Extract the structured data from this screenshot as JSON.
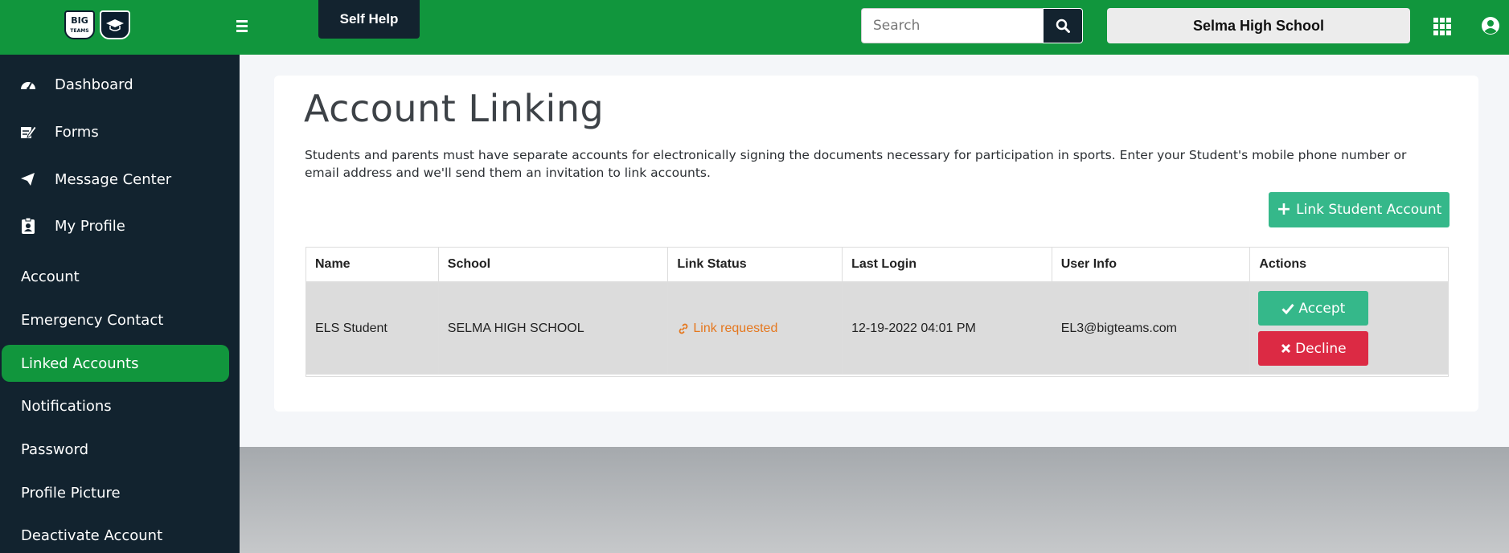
{
  "header": {
    "logo_text_1": "BIG",
    "logo_text_2": "TEAMS",
    "self_help_label": "Self Help",
    "search_placeholder": "Search",
    "school_name": "Selma High School"
  },
  "sidebar": {
    "main_items": [
      {
        "label": "Dashboard",
        "icon": "gauge-icon"
      },
      {
        "label": "Forms",
        "icon": "form-edit-icon"
      },
      {
        "label": "Message Center",
        "icon": "paper-plane-icon"
      },
      {
        "label": "My Profile",
        "icon": "id-badge-icon"
      }
    ],
    "sub_items": [
      {
        "label": "Account"
      },
      {
        "label": "Emergency Contact"
      },
      {
        "label": "Linked Accounts",
        "active": true
      },
      {
        "label": "Notifications"
      },
      {
        "label": "Password"
      },
      {
        "label": "Profile Picture"
      },
      {
        "label": "Deactivate Account"
      }
    ]
  },
  "main": {
    "title": "Account Linking",
    "description": "Students and parents must have separate accounts for electronically signing the documents necessary for participation in sports. Enter your Student's mobile phone number or email address and we'll send them an invitation to link accounts.",
    "link_button_label": "Link Student Account",
    "table": {
      "headers": [
        "Name",
        "School",
        "Link Status",
        "Last Login",
        "User Info",
        "Actions"
      ],
      "rows": [
        {
          "name": "ELS Student",
          "school": "SELMA HIGH SCHOOL",
          "status": "Link requested",
          "last_login": "12-19-2022 04:01 PM",
          "user_info": "EL3@bigteams.com",
          "accept_label": "Accept",
          "decline_label": "Decline"
        }
      ]
    }
  },
  "colors": {
    "brand_green": "#11963d",
    "sidebar_dark": "#12232f",
    "accent_teal": "#35b88a",
    "danger_red": "#dc2a44",
    "status_orange": "#e5781f"
  }
}
